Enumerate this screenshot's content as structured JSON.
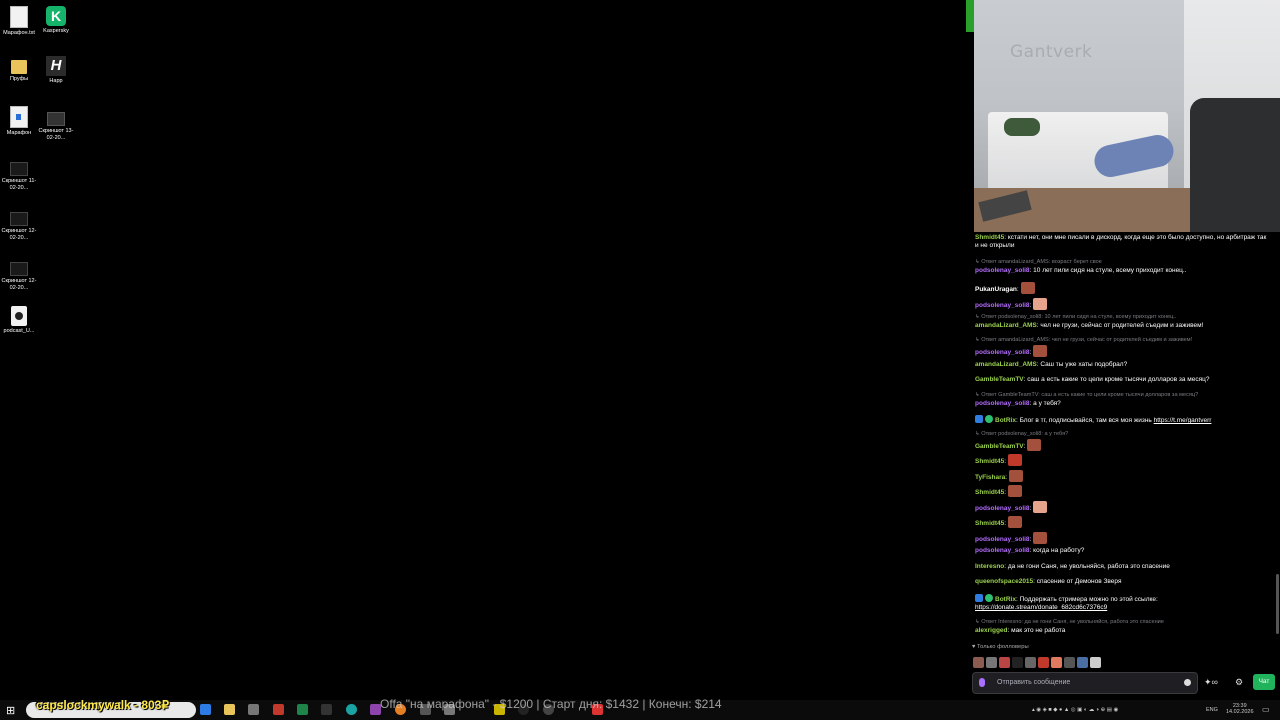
{
  "desktop": {
    "icons": [
      {
        "label": "Марафон.txt",
        "icon": "text-file-icon"
      },
      {
        "label": "Kaspersky",
        "icon": "kaspersky-icon",
        "glyph": "K"
      },
      {
        "label": "Пруфы",
        "icon": "folder-icon"
      },
      {
        "label": "Happ",
        "icon": "happ-icon",
        "glyph": "H"
      },
      {
        "label": "Марафон",
        "icon": "word-document-icon"
      },
      {
        "label": "Скриншот 13-02-20...",
        "icon": "screenshot-thumbnail-icon"
      },
      {
        "label": "Скриншот 11-02-20...",
        "icon": "screenshot-thumbnail-icon"
      },
      {
        "label": "Скриншот 12-02-20...",
        "icon": "screenshot-thumbnail-icon"
      },
      {
        "label": "Скриншот 12-02-20...",
        "icon": "screenshot-thumbnail-icon"
      },
      {
        "label": "podcast_U...",
        "icon": "media-file-icon"
      }
    ]
  },
  "stream": {
    "webcam_logo": "Gantverk"
  },
  "chat": {
    "messages": [
      {
        "type": "msg",
        "user": "Shmidt45",
        "color": "green",
        "text": ": кстати нет, они мне писали в дискорд, когда еще это было доступно, но арбитраж так и не открыли"
      },
      {
        "type": "reply",
        "text": "↳ Ответ amandaLizard_AMS: возраст берет свое"
      },
      {
        "type": "msg",
        "user": "podsolenay_soli8",
        "color": "purple",
        "text": ": 10 лет пили сидя на стуле, всему приходит конец.."
      },
      {
        "type": "msg",
        "user": "PukanUragan",
        "color": "white",
        "text": ":",
        "emote": true
      },
      {
        "type": "msg",
        "user": "podsolenay_soli8",
        "color": "purple",
        "text": ":",
        "emote": true
      },
      {
        "type": "reply",
        "text": "↳ Ответ podsolenay_soli8: 10 лет пили сидя на стуле, всему приходит конец.."
      },
      {
        "type": "msg",
        "user": "amandaLizard_AMS",
        "color": "green",
        "text": ": чел не грузи, сейчас от родителей съедим и заживем!"
      },
      {
        "type": "reply",
        "text": "↳ Ответ amandaLizard_AMS: чел не грузи, сейчас от родителей съедим и заживем!"
      },
      {
        "type": "msg",
        "user": "podsolenay_soli8",
        "color": "purple",
        "text": ":",
        "emote": true
      },
      {
        "type": "msg",
        "user": "amandaLizard_AMS",
        "color": "green",
        "text": ": Саш ты уже хаты подобрал?"
      },
      {
        "type": "msg",
        "user": "GambleTeamTV",
        "color": "green",
        "text": ": саш а есть какие то цели кроме тысячи долларов за месяц?"
      },
      {
        "type": "reply",
        "text": "↳ Ответ GambleTeamTV: саш а есть какие то цели кроме тысячи долларов за месяц?"
      },
      {
        "type": "msg",
        "user": "podsolenay_soli8",
        "color": "purple",
        "text": ": а у тебя?"
      },
      {
        "type": "msg",
        "user": "BotRix",
        "color": "green",
        "badges": true,
        "text": ": Блог в тг, подписывайся, там вся моя жизнь ",
        "link": "https://t.me/gantverr"
      },
      {
        "type": "reply",
        "text": "↳ Ответ podsolenay_soli8: а у тебя?"
      },
      {
        "type": "msg",
        "user": "GambleTeamTV",
        "color": "green",
        "text": ":",
        "emote": true
      },
      {
        "type": "msg",
        "user": "Shmidt45",
        "color": "green",
        "text": ":",
        "emote": true
      },
      {
        "type": "msg",
        "user": "TyFishara",
        "color": "green",
        "text": ":",
        "emote": true
      },
      {
        "type": "msg",
        "user": "Shmidt45",
        "color": "green",
        "text": ":",
        "emote": true
      },
      {
        "type": "msg",
        "user": "podsolenay_soli8",
        "color": "purple",
        "text": ":",
        "emote": true
      },
      {
        "type": "msg",
        "user": "Shmidt45",
        "color": "green",
        "text": ":",
        "emote": true
      },
      {
        "type": "msg",
        "user": "podsolenay_soli8",
        "color": "purple",
        "text": ":",
        "emote": true
      },
      {
        "type": "msg",
        "user": "podsolenay_soli8",
        "color": "purple",
        "text": ": когда на работу?"
      },
      {
        "type": "msg",
        "user": "Interesno",
        "color": "green",
        "text": ": да не гони Саня, не увольняйся, работа это спасение"
      },
      {
        "type": "msg",
        "user": "queenofspace2015",
        "color": "green",
        "text": ": спасение от Демонов Зверя"
      },
      {
        "type": "msg",
        "user": "BotRix",
        "color": "green",
        "badges": true,
        "text": ": Поддержать стримера можно по этой ссылке:",
        "link2": "https://donate.stream/donate_682cd6c7376c9"
      },
      {
        "type": "reply",
        "text": "↳ Ответ Interesno: да не гони Саня, не увольняйся, работа это спасение"
      },
      {
        "type": "msg",
        "user": "alexrigged",
        "color": "green",
        "text": ": мак это не работа"
      }
    ],
    "followers_only": "♥ Только фолловеры",
    "input_placeholder": "Отправить сообщение",
    "chat_button": "Чат"
  },
  "taskbar": {
    "overlay_name": "capslockmywalk - 803₽",
    "overlay_stats": "Offа \"на марафона\" - $1200 | Старт дня: $1432 | Конечн: $214",
    "tray_lang": "ENG",
    "tray_time": "23:39",
    "tray_date": "14.02.2026"
  },
  "colors": {
    "green_user": "#9bd14f",
    "purple_user": "#b46cff",
    "chat_button": "#21b35b",
    "overlay_name": "#ffe94a"
  }
}
